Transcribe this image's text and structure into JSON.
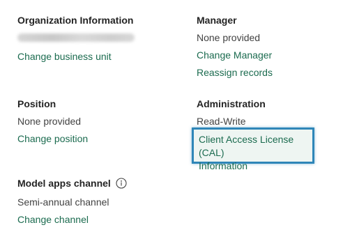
{
  "org_info": {
    "heading": "Organization Information",
    "link": "Change business unit"
  },
  "manager": {
    "heading": "Manager",
    "value": "None provided",
    "link_change": "Change Manager",
    "link_reassign": "Reassign records"
  },
  "position": {
    "heading": "Position",
    "value": "None provided",
    "link": "Change position"
  },
  "administration": {
    "heading": "Administration",
    "value": "Read-Write",
    "link_line1": "Client Access License (CAL)",
    "link_line2": "Information"
  },
  "model_apps": {
    "heading": "Model apps channel",
    "value": "Semi-annual channel",
    "link": "Change channel",
    "info_icon": "info-icon"
  },
  "colors": {
    "link": "#1b6b4f",
    "highlight_border": "#2f86b8",
    "heading": "#242424",
    "text": "#424242"
  }
}
